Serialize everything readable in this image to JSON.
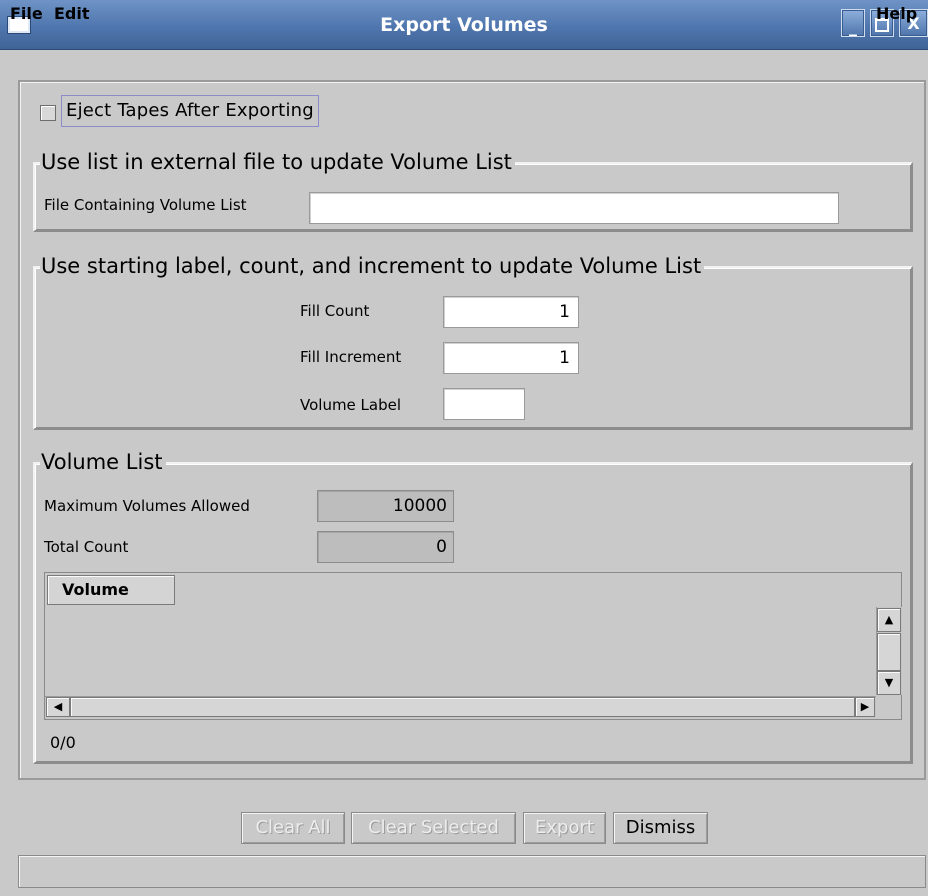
{
  "window": {
    "title": "Export Volumes",
    "title_color": "#4f76ae",
    "buttons": {
      "minimize": "_",
      "maximize": "□",
      "close": "X"
    }
  },
  "menu": {
    "file": "File",
    "edit": "Edit",
    "help": "Help"
  },
  "eject": {
    "label": "Eject Tapes After Exporting",
    "checked": false
  },
  "external_file": {
    "title": "Use list in external file to update Volume List",
    "field_label": "File Containing Volume List",
    "value": ""
  },
  "starting_label": {
    "title": "Use starting label, count, and increment to update Volume List",
    "fill_count_label": "Fill Count",
    "fill_count": "1",
    "fill_increment_label": "Fill Increment",
    "fill_increment": "1",
    "volume_label_label": "Volume Label",
    "volume_label": ""
  },
  "volume_list": {
    "title": "Volume List",
    "max_label": "Maximum Volumes Allowed",
    "max_value": "10000",
    "total_label": "Total Count",
    "total_value": "0",
    "column_header": "Volume",
    "rows": [],
    "count_text": "0/0"
  },
  "actions": {
    "clear_all": "Clear All",
    "clear_selected": "Clear Selected",
    "export": "Export",
    "dismiss": "Dismiss"
  },
  "icons": {
    "window_icon": "window-icon",
    "up": "arrow-up-icon",
    "down": "arrow-down-icon",
    "left": "arrow-left-icon",
    "right": "arrow-right-icon"
  }
}
